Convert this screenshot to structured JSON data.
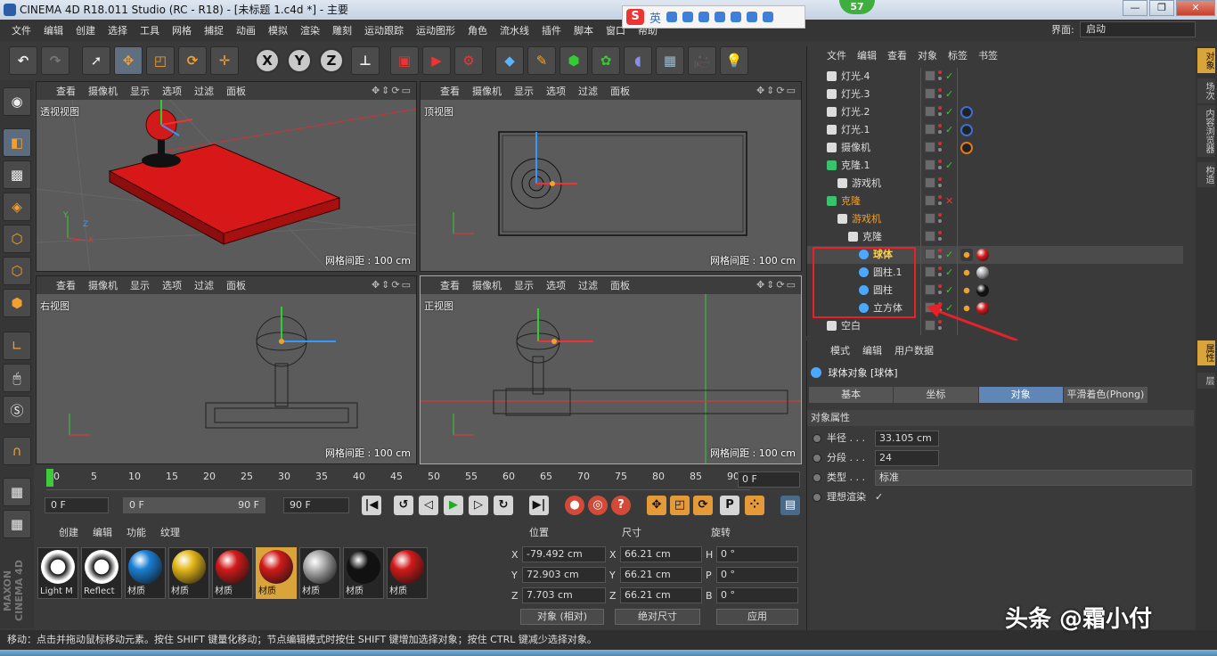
{
  "title": "CINEMA 4D R18.011 Studio (RC - R18) - [未标题 1.c4d *] - 主要",
  "ime": {
    "label": "英"
  },
  "badge": "57",
  "window_controls": [
    "—",
    "❐",
    "✕"
  ],
  "menu": [
    "文件",
    "编辑",
    "创建",
    "选择",
    "工具",
    "网格",
    "捕捉",
    "动画",
    "模拟",
    "渲染",
    "雕刻",
    "运动跟踪",
    "运动图形",
    "角色",
    "流水线",
    "插件",
    "脚本",
    "窗口",
    "帮助"
  ],
  "layout": {
    "label": "界面:",
    "value": "启动"
  },
  "toolbar_axes": [
    "X",
    "Y",
    "Z"
  ],
  "viewports": [
    {
      "name": "透视视图",
      "grid": "网格间距 : 100 cm"
    },
    {
      "name": "顶视图",
      "grid": "网格间距 : 100 cm"
    },
    {
      "name": "右视图",
      "grid": "网格间距 : 100 cm"
    },
    {
      "name": "正视图",
      "grid": "网格间距 : 100 cm"
    }
  ],
  "viewport_menu": [
    "查看",
    "摄像机",
    "显示",
    "选项",
    "过滤",
    "面板"
  ],
  "timeline": {
    "ticks": [
      "0",
      "5",
      "10",
      "15",
      "20",
      "25",
      "30",
      "35",
      "40",
      "45",
      "50",
      "55",
      "60",
      "65",
      "70",
      "75",
      "80",
      "85",
      "90"
    ],
    "current": "0 F",
    "start": "0 F",
    "range_start": "0 F",
    "range_end": "90 F",
    "end": "90 F"
  },
  "material_menu": [
    "创建",
    "编辑",
    "功能",
    "纹理"
  ],
  "materials": [
    {
      "label": "Light M",
      "color": "#ffffff",
      "type": "light"
    },
    {
      "label": "Reflect",
      "color": "#ffffff",
      "type": "light"
    },
    {
      "label": "材质",
      "color": "#1a7fd4",
      "type": "ball"
    },
    {
      "label": "材质",
      "color": "#e4b81a",
      "type": "ball"
    },
    {
      "label": "材质",
      "color": "#d11a1a",
      "type": "ball"
    },
    {
      "label": "材质",
      "color": "#d11a1a",
      "type": "ball",
      "selected": true
    },
    {
      "label": "材质",
      "color": "#aaaaaa",
      "type": "chrome"
    },
    {
      "label": "材质",
      "color": "#111111",
      "type": "ball"
    },
    {
      "label": "材质",
      "color": "#d11a1a",
      "type": "ball"
    }
  ],
  "coords": {
    "headers": [
      "位置",
      "尺寸",
      "旋转"
    ],
    "rows": [
      {
        "axis": "X",
        "pos": "-79.492 cm",
        "size_axis": "X",
        "size": "66.21 cm",
        "rot_axis": "H",
        "rot": "0 °"
      },
      {
        "axis": "Y",
        "pos": "72.903 cm",
        "size_axis": "Y",
        "size": "66.21 cm",
        "rot_axis": "P",
        "rot": "0 °"
      },
      {
        "axis": "Z",
        "pos": "7.703 cm",
        "size_axis": "Z",
        "size": "66.21 cm",
        "rot_axis": "B",
        "rot": "0 °"
      }
    ],
    "mode": "对象 (相对)",
    "size_mode": "绝对尺寸",
    "apply": "应用"
  },
  "status": "移动：点击并拖动鼠标移动元素。按住 SHIFT 键量化移动；节点编辑模式时按住 SHIFT 键增加选择对象；按住 CTRL 键减少选择对象。",
  "object_menu": [
    "文件",
    "编辑",
    "查看",
    "对象",
    "标签",
    "书签"
  ],
  "objects": [
    {
      "name": "灯光.4",
      "indent": 0,
      "icon": "#dddddd",
      "mark": "check"
    },
    {
      "name": "灯光.3",
      "indent": 0,
      "icon": "#dddddd",
      "mark": "check"
    },
    {
      "name": "灯光.2",
      "indent": 0,
      "icon": "#dddddd",
      "mark": "check",
      "tags": [
        "#3a6fd6"
      ]
    },
    {
      "name": "灯光.1",
      "indent": 0,
      "icon": "#dddddd",
      "mark": "check",
      "tags": [
        "#3a6fd6"
      ]
    },
    {
      "name": "摄像机",
      "indent": 0,
      "icon": "#dddddd",
      "mark": "none",
      "tags": [
        "#e07a1a"
      ]
    },
    {
      "name": "克隆.1",
      "indent": 0,
      "icon": "#39c46b",
      "mark": "check"
    },
    {
      "name": "游戏机",
      "indent": 1,
      "icon": "#dddddd",
      "mark": "none"
    },
    {
      "name": "克隆",
      "indent": 0,
      "icon": "#39c46b",
      "mark": "x",
      "orange": true
    },
    {
      "name": "游戏机",
      "indent": 1,
      "icon": "#dddddd",
      "mark": "none",
      "orange": true
    },
    {
      "name": "克隆",
      "indent": 2,
      "icon": "#dddddd",
      "mark": "none"
    },
    {
      "name": "球体",
      "indent": 3,
      "icon": "#4aa8ff",
      "mark": "check",
      "highlight": true,
      "tags": [
        "#d11a1a"
      ]
    },
    {
      "name": "圆柱.1",
      "indent": 3,
      "icon": "#4aa8ff",
      "mark": "check",
      "tags": [
        "#aaaaaa"
      ]
    },
    {
      "name": "圆柱",
      "indent": 3,
      "icon": "#4aa8ff",
      "mark": "check",
      "tags": [
        "#111111"
      ]
    },
    {
      "name": "立方体",
      "indent": 3,
      "icon": "#4aa8ff",
      "mark": "check",
      "tags": [
        "#d11a1a"
      ]
    },
    {
      "name": "空白",
      "indent": 0,
      "icon": "#dddddd",
      "mark": "none"
    }
  ],
  "attr_menu": [
    "模式",
    "编辑",
    "用户数据"
  ],
  "attr_title": "球体对象 [球体]",
  "attr_tabs": [
    "基本",
    "坐标",
    "对象",
    "平滑着色(Phong)"
  ],
  "attr_section": "对象属性",
  "attrs": [
    {
      "label": "半径 . . .",
      "value": "33.105 cm"
    },
    {
      "label": "分段 . . .",
      "value": "24"
    },
    {
      "label": "类型 . . .",
      "value": "标准"
    },
    {
      "label": "理想渲染",
      "value": "✓"
    }
  ],
  "side_tabs": [
    "对象",
    "场次",
    "内容浏览器",
    "构造",
    "属性",
    "层"
  ],
  "watermark": "头条 @霜小付",
  "maxon": "MAXON CINEMA 4D",
  "colors": {
    "accent": "#5f86b7",
    "highlight": "#d9a43a",
    "redbox": "#e8202a"
  }
}
